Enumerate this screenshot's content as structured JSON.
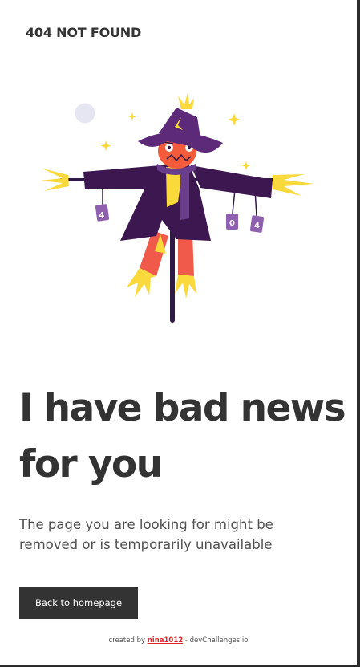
{
  "header": {
    "brand": "404 NOT FOUND"
  },
  "illustration": {
    "subject": "scarecrow-illustration",
    "can_labels": [
      "4",
      "0",
      "4"
    ],
    "colors": {
      "coat": "#3d1750",
      "hat": "#5d2a7a",
      "face": "#f35b3b",
      "straw": "#f9d93b",
      "pants": "#f05a4a",
      "moon": "#e6e6f2"
    }
  },
  "main": {
    "headline": "I have bad news for you",
    "message": "The page you are looking for might be removed or is temporarily unavailable",
    "cta_label": "Back to homepage"
  },
  "footer": {
    "prefix": "created by",
    "author": "nina1012",
    "suffix": "- devChallenges.io"
  }
}
